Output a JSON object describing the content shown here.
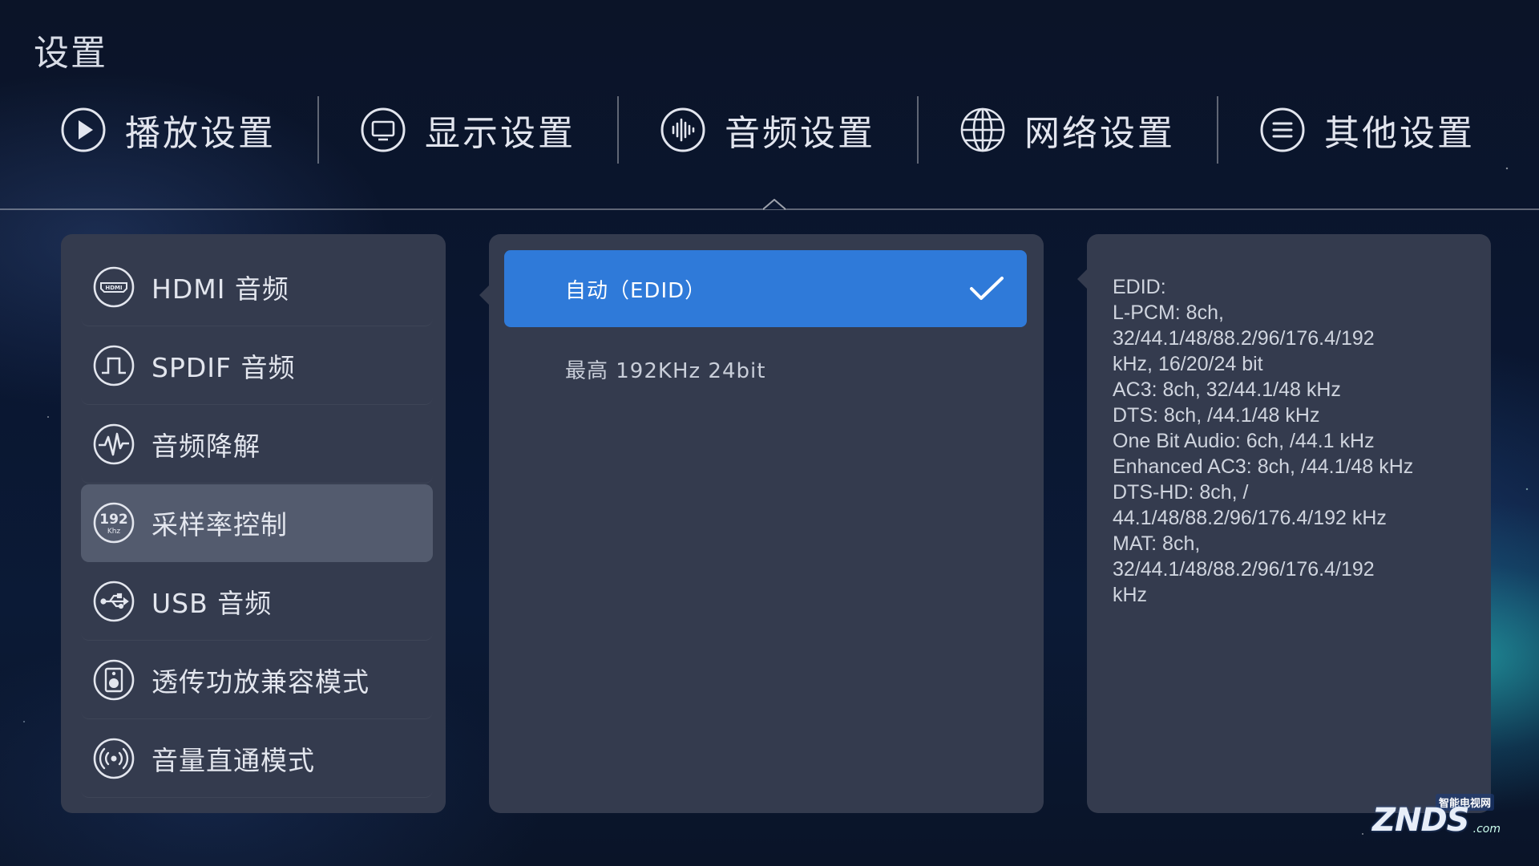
{
  "page": {
    "title": "设置"
  },
  "tabs": [
    {
      "label": "播放设置",
      "icon": "play-circle-icon"
    },
    {
      "label": "显示设置",
      "icon": "monitor-icon"
    },
    {
      "label": "音频设置",
      "icon": "audio-wave-icon",
      "active": true
    },
    {
      "label": "网络设置",
      "icon": "globe-icon"
    },
    {
      "label": "其他设置",
      "icon": "menu-list-icon"
    }
  ],
  "sidebar": {
    "items": [
      {
        "label": "HDMI 音频",
        "icon": "hdmi-icon"
      },
      {
        "label": "SPDIF 音频",
        "icon": "spdif-icon"
      },
      {
        "label": "音频降解",
        "icon": "waveform-icon"
      },
      {
        "label": "采样率控制",
        "icon": "192khz-icon",
        "icon_text": "192",
        "icon_subtext": "Khz",
        "active": true
      },
      {
        "label": "USB 音频",
        "icon": "usb-icon"
      },
      {
        "label": "透传功放兼容模式",
        "icon": "speaker-icon"
      },
      {
        "label": "音量直通模式",
        "icon": "broadcast-icon"
      }
    ]
  },
  "options": {
    "items": [
      {
        "label": "自动（EDID）",
        "selected": true
      },
      {
        "label": "最高 192KHz 24bit",
        "selected": false
      }
    ]
  },
  "info": {
    "text": "EDID:\nL-PCM: 8ch,\n32/44.1/48/88.2/96/176.4/192\nkHz, 16/20/24 bit\nAC3: 8ch, 32/44.1/48 kHz\nDTS: 8ch, /44.1/48 kHz\nOne Bit Audio: 6ch, /44.1 kHz\nEnhanced AC3: 8ch, /44.1/48 kHz\nDTS-HD: 8ch, /\n44.1/48/88.2/96/176.4/192 kHz\nMAT: 8ch,\n32/44.1/48/88.2/96/176.4/192\nkHz"
  },
  "watermark": {
    "top": "智能电视网",
    "main": "ZNDS",
    "suffix": ".com"
  },
  "colors": {
    "accent": "#2f7ad9",
    "panel": "#343b4e",
    "active_item": "#535b6e"
  }
}
